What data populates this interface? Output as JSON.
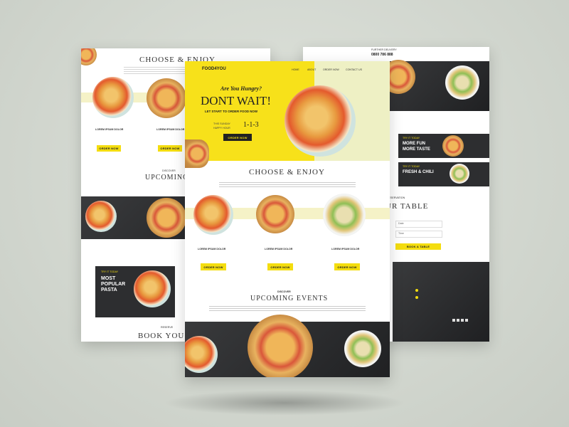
{
  "left_page": {
    "title": "CHOOSE & ENJOY",
    "item1_label": "LOREM IPSUM DOLOR",
    "item2_label": "LOREM IPSUM DOLOR",
    "order_button": "ORDER NOW",
    "discover": "DISCOVER",
    "events_title": "UPCOMING EV",
    "promo_try": "TRY IT TODAY",
    "promo_line1": "MOST",
    "promo_line2": "POPULAR",
    "promo_line3": "PASTA",
    "reserve": "RESERVE",
    "book": "BOOK YOU"
  },
  "right_page": {
    "contact_label": "FURTHER DELIVERY",
    "phone": "0800 786 888",
    "promo1_try": "TRY IT TODAY",
    "promo1_line1": "MORE FUN",
    "promo1_line2": "MORE TASTE",
    "promo2_try": "TRY IT TODAY",
    "promo2_line1": "FRESH & CHILI",
    "reservation": "RESERVATION",
    "table_title": "UR TABLE",
    "field1": "Date",
    "field2": "Time",
    "button": "BOOK A TABLE"
  },
  "center_page": {
    "brand": "FOOD4YOU",
    "nav": [
      "HOME",
      "ABOUT",
      "ORDER NOW",
      "CONTACT US"
    ],
    "hungry": "Are You Hungry?",
    "headline": "DONT WAIT!",
    "subhead": "LET START TO ORDER FOOD NOW",
    "offer_text1": "THIS SUNDAY",
    "offer_text2": "HAPPY HOUR",
    "offer_numbers": "1-1-3",
    "order_button": "ORDER NOW",
    "choose_title": "CHOOSE & ENJOY",
    "items": [
      {
        "label": "LOREM IPSUM DOLOR",
        "button": "ORDER NOW"
      },
      {
        "label": "LOREM IPSUM DOLOR",
        "button": "ORDER NOW"
      },
      {
        "label": "LOREM IPSUM DOLOR",
        "button": "ORDER NOW"
      }
    ],
    "discover": "DISCOVER",
    "events_title": "UPCOMING EVENTS"
  },
  "colors": {
    "accent": "#f4dd0f",
    "background": "#d3d8d0",
    "dark": "#2d2e30"
  }
}
